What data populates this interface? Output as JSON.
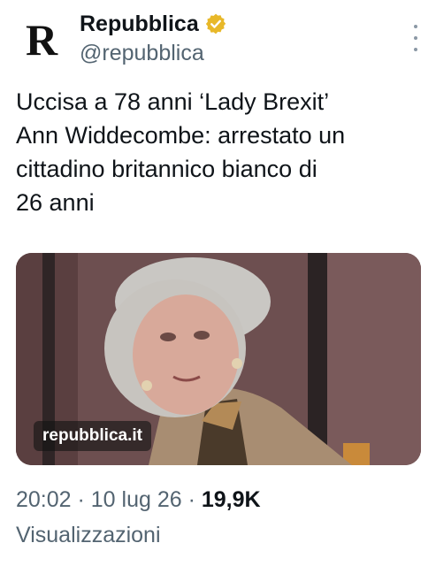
{
  "account": {
    "display_name": "Repubblica",
    "handle": "@repubblica",
    "avatar_letter": "R",
    "verified_color": "#e8b829"
  },
  "tweet": {
    "text": "Uccisa a 78 anni ‘Lady Brexit’\nAnn Widdecombe: arrestato un\ncittadino britannico bianco di\n26 anni"
  },
  "media": {
    "watermark": "repubblica.it"
  },
  "meta": {
    "time": "20:02",
    "date": "10 lug 26",
    "separator": " · ",
    "views_count": "19,9K",
    "views_label": "Visualizzazioni"
  },
  "icons": {
    "verified": "verified-badge-icon",
    "more": "more-options-icon"
  }
}
